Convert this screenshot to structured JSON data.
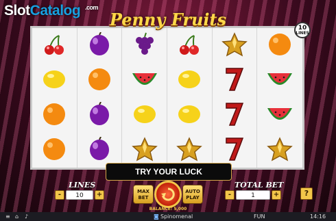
{
  "watermark": {
    "part1": "Slot",
    "part2": "Catalog",
    "suffix": ".com"
  },
  "game_title": "Penny Fruits",
  "lines_badge": {
    "value": "10",
    "label": "LINES"
  },
  "reels": [
    [
      "cherry",
      "lemon",
      "orange",
      "orange"
    ],
    [
      "plum",
      "orange",
      "plum",
      "plum"
    ],
    [
      "grapes",
      "watermelon",
      "lemon",
      "star"
    ],
    [
      "cherry",
      "lemon",
      "lemon",
      "star"
    ],
    [
      "star",
      "seven",
      "seven",
      "seven"
    ],
    [
      "orange",
      "watermelon",
      "watermelon",
      "star"
    ]
  ],
  "message": "TRY YOUR LUCK",
  "controls": {
    "lines_label": "LINES",
    "lines_value": "10",
    "minus": "-",
    "plus": "+",
    "max_bet": [
      "MAX",
      "BET"
    ],
    "auto_play": [
      "AUTO",
      "PLAY"
    ],
    "total_bet_label": "TOTAL BET",
    "total_bet_value": "1",
    "help": "?",
    "balance": "BALANCE: 5,000"
  },
  "taskbar": {
    "app": "Spinomenal",
    "mode": "FUN",
    "time": "14:16"
  },
  "colors": {
    "gold": "#f2c64a",
    "spin_red": "#c0200a",
    "frame": "#f4f4f4"
  }
}
